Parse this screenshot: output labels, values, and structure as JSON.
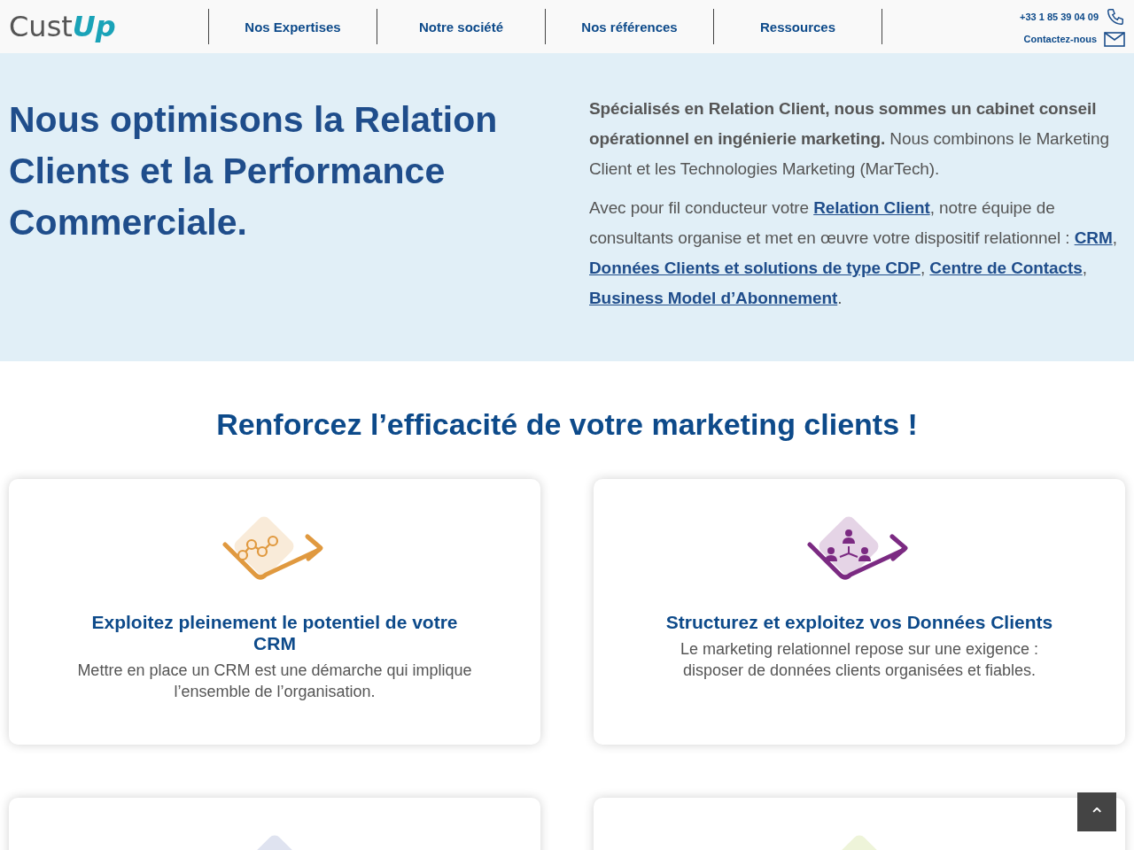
{
  "header": {
    "logo": {
      "first": "Cust",
      "second": "Up"
    },
    "nav": [
      {
        "label": "Nos Expertises"
      },
      {
        "label": "Notre société"
      },
      {
        "label": "Nos références"
      },
      {
        "label": "Ressources"
      }
    ],
    "phone": "+33 1 85 39 04 09",
    "contact": "Contactez-nous"
  },
  "hero": {
    "title": "Nous optimisons la Relation Clients et la Performance Commerciale.",
    "intro": "**Spécialisés en Relation Client, nous sommes un cabinet conseil opérationnel en ingénierie marketing.** Nous combinons le Marketing Client et les Technologies Marketing (MarTech).",
    "paragraph": [
      {
        "kind": "text",
        "text": "Avec pour fil conducteur votre "
      },
      {
        "kind": "link",
        "text": "Relation Client"
      },
      {
        "kind": "text",
        "text": ", notre équipe de consultants organise et met en œuvre votre dispositif relationnel : "
      },
      {
        "kind": "link",
        "text": "CRM"
      },
      {
        "kind": "text",
        "text": ", "
      },
      {
        "kind": "link",
        "text": "Données Clients et solutions de type CDP"
      },
      {
        "kind": "text",
        "text": ", "
      },
      {
        "kind": "link",
        "text": "Centre de Contacts"
      },
      {
        "kind": "text",
        "text": ", "
      },
      {
        "kind": "link",
        "text": "Business Model d’Abonnement"
      },
      {
        "kind": "text",
        "text": "."
      }
    ]
  },
  "section": {
    "title": "Renforcez l’efficacité de votre marketing clients !",
    "cards": [
      {
        "kind": "chart",
        "color": "#e0993f",
        "title": "Exploitez pleinement le potentiel de votre CRM",
        "text": "Mettre en place un CRM est une démarche qui implique l’ensemble de l’organisation."
      },
      {
        "kind": "people",
        "color": "#7b2a82",
        "title": "Structurez et exploitez vos Données Clients",
        "text": "Le marketing relationnel repose sur une exigence : disposer de données clients organisées et fiables."
      },
      {
        "color": "#dfe3f0"
      },
      {
        "color": "#eef4d9"
      }
    ]
  },
  "back_to_top": {
    "label": "⌃"
  }
}
